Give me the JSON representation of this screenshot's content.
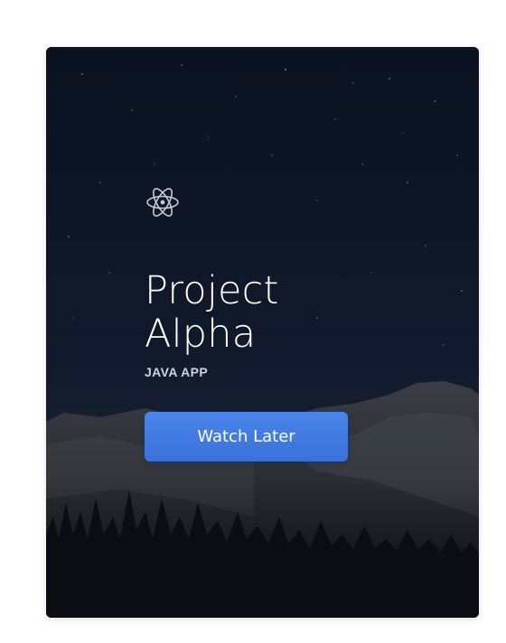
{
  "card": {
    "icon": "atom-icon",
    "title_line1": "Project",
    "title_line2": "Alpha",
    "subtitle": "JAVA APP",
    "button_label": "Watch Later"
  },
  "colors": {
    "button": "#3f78e0",
    "card_bg": "#0f1729",
    "text": "#ffffff"
  }
}
